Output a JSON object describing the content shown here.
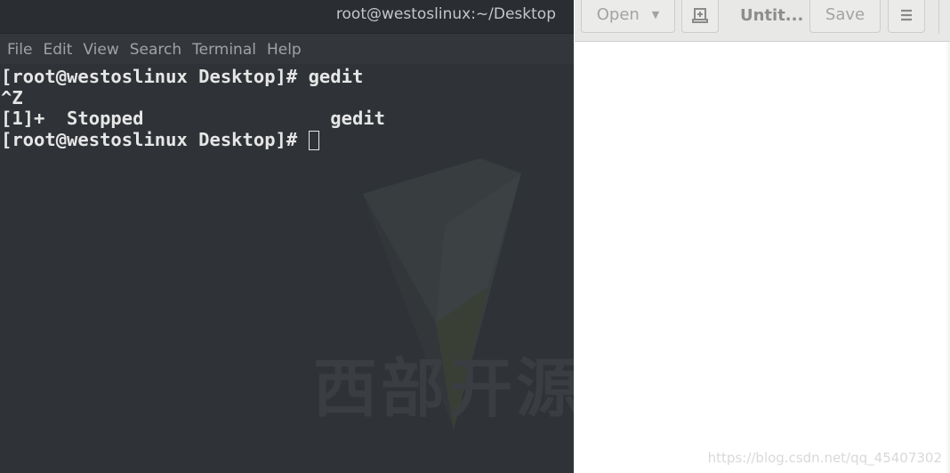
{
  "terminal": {
    "title": "root@westoslinux:~/Desktop",
    "menu": [
      "File",
      "Edit",
      "View",
      "Search",
      "Terminal",
      "Help"
    ],
    "lines": [
      "[root@westoslinux Desktop]# gedit",
      "^Z",
      "[1]+  Stopped                 gedit",
      "[root@westoslinux Desktop]# "
    ],
    "background_logo_text": "西部开源"
  },
  "gedit": {
    "open_label": "Open",
    "title": "Untit...",
    "save_label": "Save",
    "icons": {
      "open_dropdown": "chevron-down-icon",
      "new_tab": "new-document-icon",
      "menu": "hamburger-menu-icon"
    }
  },
  "watermark": "https://blog.csdn.net/qq_45407302"
}
